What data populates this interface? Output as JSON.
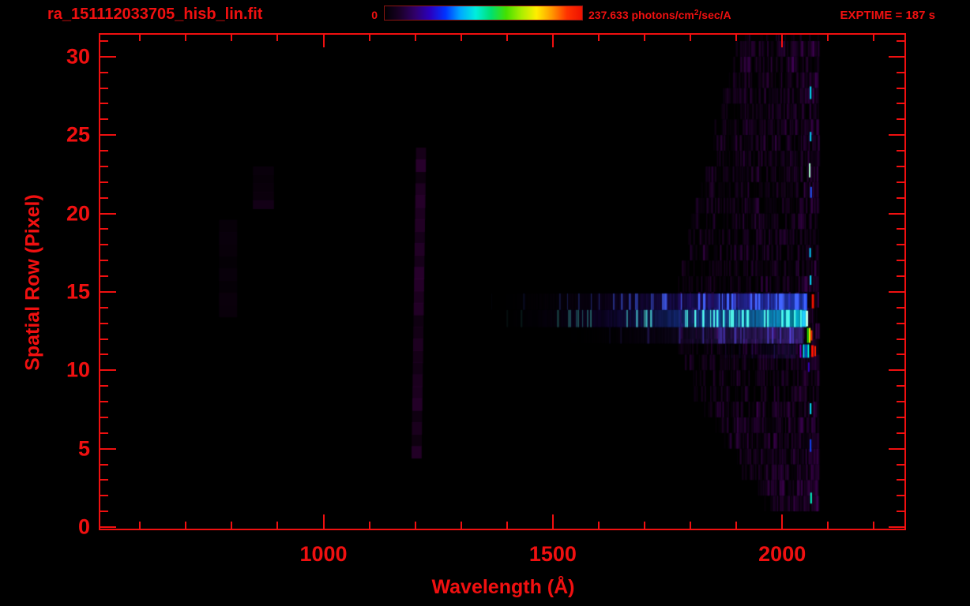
{
  "window": {
    "background": "#000000",
    "accent": "#f01010"
  },
  "header": {
    "filename": "ra_151112033705_hisb_lin.fit",
    "exptime_label": "EXPTIME = 187 s"
  },
  "colorbar": {
    "min_label": "0",
    "max_prefix": "237.633 photons/cm",
    "max_sup": "2",
    "max_suffix": "/sec/A",
    "stops": [
      "#000000",
      "#1a0028",
      "#30006a",
      "#2a00c0",
      "#0033ff",
      "#00aaff",
      "#00eedd",
      "#00e070",
      "#44e000",
      "#aaee00",
      "#ffee00",
      "#ff9900",
      "#ff3300",
      "#ee1100"
    ]
  },
  "chart_data": {
    "type": "heatmap",
    "title": "ra_151112033705_hisb_lin.fit",
    "xlabel": "Wavelength (Å)",
    "ylabel": "Spatial Row (Pixel)",
    "x_range": [
      510,
      2270
    ],
    "y_range": [
      -0.2,
      31.5
    ],
    "x_ticks": [
      1000,
      1500,
      2000
    ],
    "x_minor_step": 100,
    "x_minor_from": 600,
    "x_minor_to": 2200,
    "y_ticks": [
      0,
      5,
      10,
      15,
      20,
      25,
      30
    ],
    "y_minor_step": 1,
    "intensity_min": 0,
    "intensity_max": 237.633,
    "intensity_units": "photons/cm²/sec/A",
    "grid": false,
    "features": [
      {
        "type": "wedge",
        "seed": 7,
        "count": 3000,
        "x_end": 2078,
        "x_top": 1905,
        "rows_top": 31.2,
        "x_hi": 1772,
        "rows_hi": 16.0,
        "x_lo": 1772,
        "rows_lo": 10.6,
        "x_bot": 1968,
        "rows_bot": 1.3,
        "color": "#6a0a8a",
        "alpha": 0.3
      },
      {
        "type": "vband",
        "seed": 3,
        "x0": 1192,
        "x1": 1214,
        "r0": 4.4,
        "r1": 24.2,
        "slant_a": 10,
        "segments": 26,
        "color": "#55005e",
        "alpha": 0.5
      },
      {
        "type": "vband",
        "seed": 4,
        "x0": 846,
        "x1": 892,
        "r0": 20.3,
        "r1": 23.0,
        "slant_a": 0,
        "segments": 5,
        "color": "#33003a",
        "alpha": 0.4
      },
      {
        "type": "vband",
        "seed": 5,
        "x0": 772,
        "x1": 812,
        "r0": 13.4,
        "r1": 19.6,
        "slant_a": 0,
        "segments": 8,
        "color": "#26002c",
        "alpha": 0.3
      },
      {
        "type": "streak",
        "seed": 11,
        "r0": 13.85,
        "r1": 14.9,
        "x0": 1290,
        "x1": 2052,
        "gamma": 1.7,
        "alpha": 0.95,
        "ramp": [
          "#1c0024",
          "#3a0060",
          "#3a22cc",
          "#2a55ff"
        ],
        "stripe": "#4466ff",
        "stripe_p": 0.3
      },
      {
        "type": "streak",
        "seed": 12,
        "r0": 12.75,
        "r1": 13.85,
        "x0": 1330,
        "x1": 2050,
        "gamma": 1.5,
        "alpha": 1.0,
        "ramp": [
          "#20002a",
          "#4400aa",
          "#2266ff",
          "#00d5ee"
        ],
        "stripe": "#55ffee",
        "stripe_p": 0.33
      },
      {
        "type": "streak",
        "seed": 13,
        "r0": 11.7,
        "r1": 12.75,
        "x0": 1420,
        "x1": 2046,
        "gamma": 1.8,
        "alpha": 0.6,
        "ramp": [
          "#16001e",
          "#30004a",
          "#5533bb",
          "#6644dd"
        ],
        "stripe": "#5544dd",
        "stripe_p": 0.22
      },
      {
        "type": "streak",
        "seed": 14,
        "r0": 10.75,
        "r1": 11.65,
        "x0": 1820,
        "x1": 2030,
        "gamma": 1.6,
        "alpha": 0.45,
        "ramp": [
          "#10001a",
          "#20002f",
          "#2a1060",
          "#342080"
        ],
        "stripe": "#341f90",
        "stripe_p": 0.2
      },
      {
        "type": "marks",
        "items": [
          {
            "x": 2067,
            "w": 3,
            "r0": 13.95,
            "r1": 14.85,
            "c": "#ee1100"
          },
          {
            "x": 2054,
            "w": 3,
            "r0": 12.8,
            "r1": 13.8,
            "c": "#bfffe0"
          },
          {
            "x": 2047,
            "w": 4,
            "r0": 12.8,
            "r1": 13.8,
            "c": "#22ccff"
          },
          {
            "x": 2056,
            "w": 2,
            "r0": 11.75,
            "r1": 12.7,
            "c": "#22dd00"
          },
          {
            "x": 2060,
            "w": 2,
            "r0": 11.75,
            "r1": 12.7,
            "c": "#ffee00"
          },
          {
            "x": 2064,
            "w": 2,
            "r0": 11.9,
            "r1": 12.55,
            "c": "#ff3300"
          },
          {
            "x": 2040,
            "w": 2,
            "r0": 10.8,
            "r1": 11.65,
            "c": "#7700cc"
          },
          {
            "x": 2047,
            "w": 2,
            "r0": 10.8,
            "r1": 11.65,
            "c": "#00ddff"
          },
          {
            "x": 2052,
            "w": 2,
            "r0": 10.8,
            "r1": 11.65,
            "c": "#0066ff"
          },
          {
            "x": 2057,
            "w": 2,
            "r0": 10.8,
            "r1": 11.65,
            "c": "#00ffee"
          },
          {
            "x": 2066,
            "w": 3,
            "r0": 10.85,
            "r1": 11.6,
            "c": "#ff1100"
          },
          {
            "x": 2072,
            "w": 2,
            "r0": 10.9,
            "r1": 11.55,
            "c": "#ff2200"
          },
          {
            "x": 2062,
            "w": 2,
            "r0": 27.3,
            "r1": 28.1,
            "c": "#00e5ff"
          },
          {
            "x": 2062,
            "w": 2,
            "r0": 24.6,
            "r1": 25.2,
            "c": "#00d0ff"
          },
          {
            "x": 2060,
            "w": 2,
            "r0": 22.3,
            "r1": 23.2,
            "c": "#aaffcc"
          },
          {
            "x": 2063,
            "w": 2,
            "r0": 21.0,
            "r1": 21.7,
            "c": "#2255ff"
          },
          {
            "x": 2061,
            "w": 2,
            "r0": 17.2,
            "r1": 17.8,
            "c": "#00ccff"
          },
          {
            "x": 2062,
            "w": 2,
            "r0": 15.45,
            "r1": 16.05,
            "c": "#00e5ff"
          },
          {
            "x": 2058,
            "w": 2,
            "r0": 9.9,
            "r1": 10.5,
            "c": "#3300bb"
          },
          {
            "x": 2062,
            "w": 2,
            "r0": 7.2,
            "r1": 7.9,
            "c": "#00e5ff"
          },
          {
            "x": 2062,
            "w": 2,
            "r0": 4.8,
            "r1": 5.6,
            "c": "#1144ff"
          },
          {
            "x": 2063,
            "w": 2,
            "r0": 1.5,
            "r1": 2.2,
            "c": "#00ffcc"
          }
        ]
      }
    ]
  }
}
